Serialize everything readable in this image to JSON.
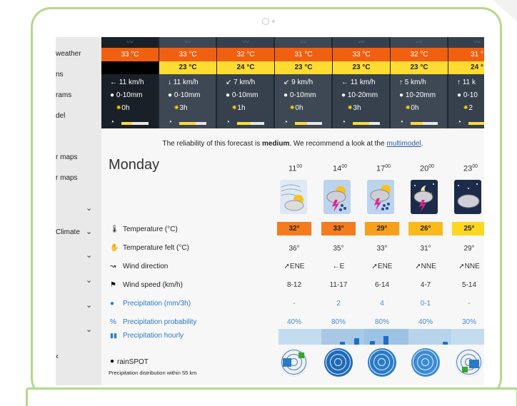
{
  "colors": {
    "accent_green": "#b3d98a",
    "strip": "#1f2830",
    "tmax": "#f06010",
    "tmin": "#ffdc32",
    "link": "#2a5ea8"
  },
  "sidebar": {
    "items": [
      "weather",
      "ns",
      "rams",
      "del",
      "r maps",
      "r maps",
      "Climate"
    ],
    "expand_icon": "chevron-down-icon",
    "arrow": "‹"
  },
  "strip": {
    "wave_glyph": "〰",
    "columns": [
      {
        "tmax": "33 °C",
        "tmin": "",
        "wind": "11 km/h",
        "wind_arrow": "←",
        "precip": "0-10mm",
        "sun": "0h",
        "sun_fraction": 0.0
      },
      {
        "tmax": "33 °C",
        "tmin": "23 °C",
        "wind": "11 km/h",
        "wind_arrow": "↓",
        "precip": "0-10mm",
        "sun": "3h",
        "sun_fraction": 0.2
      },
      {
        "tmax": "32 °C",
        "tmin": "24 °C",
        "wind": "7 km/h",
        "wind_arrow": "↙",
        "precip": "0-10mm",
        "sun": "1h",
        "sun_fraction": 0.1
      },
      {
        "tmax": "31 °C",
        "tmin": "23 °C",
        "wind": "9 km/h",
        "wind_arrow": "↙",
        "precip": "0-10mm",
        "sun": "0h",
        "sun_fraction": 0.05
      },
      {
        "tmax": "33 °C",
        "tmin": "23 °C",
        "wind": "11 km/h",
        "wind_arrow": "←",
        "precip": "10-20mm",
        "sun": "3h",
        "sun_fraction": 0.2
      },
      {
        "tmax": "32 °C",
        "tmin": "23 °C",
        "wind": "5 km/h",
        "wind_arrow": "↑",
        "precip": "10-20mm",
        "sun": "0h",
        "sun_fraction": 0.05
      },
      {
        "tmax": "31 °",
        "tmin": "24 °",
        "wind": "11 k",
        "wind_arrow": "↑",
        "precip": "0-10",
        "sun": "2",
        "sun_fraction": 0.3
      }
    ]
  },
  "reliability": {
    "prefix": "The reliability of this forecast is ",
    "level": "medium",
    "middle": ". We recommend a look at the ",
    "link": "multimodel",
    "suffix": "."
  },
  "day": "Monday",
  "hours": [
    {
      "h": "11",
      "m": "00"
    },
    {
      "h": "14",
      "m": "00"
    },
    {
      "h": "17",
      "m": "00"
    },
    {
      "h": "20",
      "m": "00"
    },
    {
      "h": "23",
      "m": "00"
    }
  ],
  "rows": {
    "temperature": {
      "label": "Temperature (°C)",
      "values": [
        "32°",
        "33°",
        "29°",
        "26°",
        "25°"
      ],
      "colors": [
        "#f57b1f",
        "#f57b1f",
        "#f9a01b",
        "#fbba1c",
        "#fcd71f"
      ]
    },
    "felt": {
      "label": "Temperature felt (°C)",
      "values": [
        "36°",
        "35°",
        "33°",
        "31°",
        "29°"
      ]
    },
    "wind_dir": {
      "label": "Wind direction",
      "values": [
        "ENE",
        "E",
        "ENE",
        "NNE",
        "NNE"
      ],
      "arrows": [
        "➚",
        "←",
        "➚",
        "➚",
        "➚"
      ]
    },
    "wind_speed": {
      "label": "Wind speed (km/h)",
      "values": [
        "8-12",
        "11-17",
        "6-14",
        "4-7",
        "5-14"
      ]
    },
    "precip": {
      "label": "Precipitation (mm/3h)",
      "values": [
        "-",
        "2",
        "4",
        "0-1",
        "-"
      ]
    },
    "prob": {
      "label": "Precipitation probability",
      "values": [
        "40%",
        "80%",
        "80%",
        "40%",
        "30%"
      ]
    },
    "hourly": {
      "label": "Precipitation hourly"
    }
  },
  "rainspot": {
    "title": "rainSPOT",
    "subtitle": "Precipitation distribution within 55 km"
  }
}
